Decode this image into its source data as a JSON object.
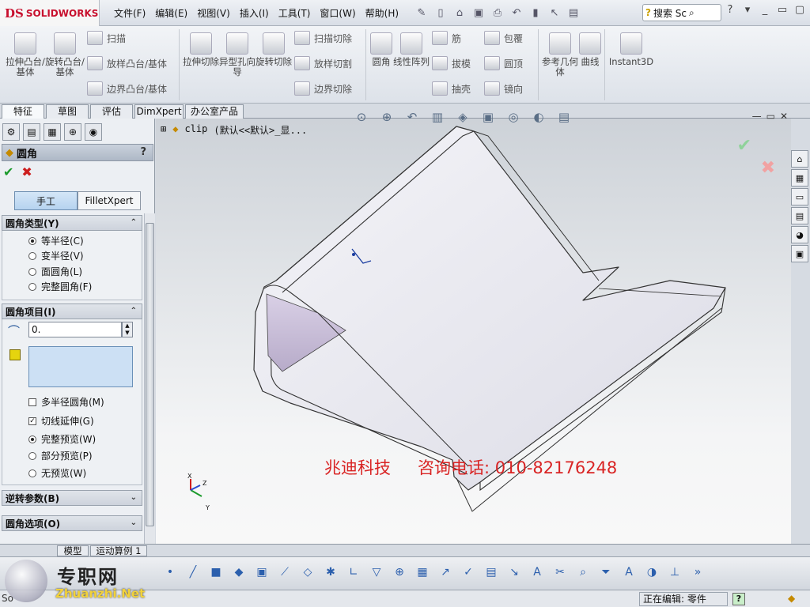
{
  "app": {
    "brand_mark": "DS",
    "brand_name": "SOLIDWORKS"
  },
  "menu": [
    "文件(F)",
    "编辑(E)",
    "视图(V)",
    "插入(I)",
    "工具(T)",
    "窗口(W)",
    "帮助(H)"
  ],
  "search": {
    "label": "搜索 Sc"
  },
  "window_controls": [
    "?",
    "▾",
    "_",
    "▭",
    "▢"
  ],
  "ribbon": {
    "big": [
      {
        "id": "extrude-boss",
        "label": "拉伸凸台/基体"
      },
      {
        "id": "revolve-boss",
        "label": "旋转凸台/基体"
      },
      {
        "id": "extrude-cut",
        "label": "拉伸切除"
      },
      {
        "id": "hole-wizard",
        "label": "异型孔向导"
      },
      {
        "id": "revolve-cut",
        "label": "旋转切除"
      },
      {
        "id": "fillet",
        "label": "圆角"
      },
      {
        "id": "linear-pattern",
        "label": "线性阵列"
      },
      {
        "id": "ref-geometry",
        "label": "参考几何体"
      },
      {
        "id": "curves",
        "label": "曲线"
      },
      {
        "id": "instant3d",
        "label": "Instant3D"
      }
    ],
    "small": [
      {
        "id": "sweep",
        "label": "扫描"
      },
      {
        "id": "loft-boss",
        "label": "放样凸台/基体"
      },
      {
        "id": "boundary-boss",
        "label": "边界凸台/基体"
      },
      {
        "id": "sweep-cut",
        "label": "扫描切除"
      },
      {
        "id": "loft-cut",
        "label": "放样切割"
      },
      {
        "id": "boundary-cut",
        "label": "边界切除"
      },
      {
        "id": "rib",
        "label": "筋"
      },
      {
        "id": "draft",
        "label": "拔模"
      },
      {
        "id": "shell",
        "label": "抽壳"
      },
      {
        "id": "wrap",
        "label": "包覆"
      },
      {
        "id": "dome",
        "label": "圆顶"
      },
      {
        "id": "mirror",
        "label": "镜向"
      }
    ]
  },
  "command_tabs": [
    "特征",
    "草图",
    "评估",
    "DimXpert",
    "办公室产品"
  ],
  "property_manager": {
    "title": "圆角",
    "help": "?",
    "mode_tabs": [
      "手工",
      "FilletXpert"
    ],
    "fillet_type": {
      "title": "圆角类型(Y)",
      "options": [
        "等半径(C)",
        "变半径(V)",
        "面圆角(L)",
        "完整圆角(F)"
      ],
      "selected": 0
    },
    "fillet_items": {
      "title": "圆角项目(I)",
      "radius_value": "0.",
      "multi_radius": "多半径圆角(M)",
      "multi_radius_checked": false,
      "tangent_propagation": "切线延伸(G)",
      "tangent_propagation_checked": true,
      "preview": [
        "完整预览(W)",
        "部分预览(P)",
        "无预览(W)"
      ],
      "preview_selected": 0
    },
    "setback": {
      "title": "逆转参数(B)"
    },
    "fillet_options": {
      "title": "圆角选项(O)"
    }
  },
  "viewport": {
    "tree_node": "clip",
    "config": "(默认<<默认>_显...",
    "watermark_company": "兆迪科技",
    "watermark_phone": "咨询电话: 010-82176248",
    "triad": {
      "x": "X",
      "y": "Y",
      "z": "Z"
    }
  },
  "bottom_tabs": [
    "模型",
    "运动算例 1"
  ],
  "status": {
    "left": "So",
    "editing": "正在编辑: 零件"
  },
  "overlay_brand": {
    "name": "专职网",
    "url": "Zhuanzhi.Net"
  },
  "colors": {
    "accent": "#c8102e",
    "ok": "#1a9a2a",
    "cancel": "#cc1d1d",
    "watermark": "#d92424",
    "selection_box": "#cce0f4"
  }
}
